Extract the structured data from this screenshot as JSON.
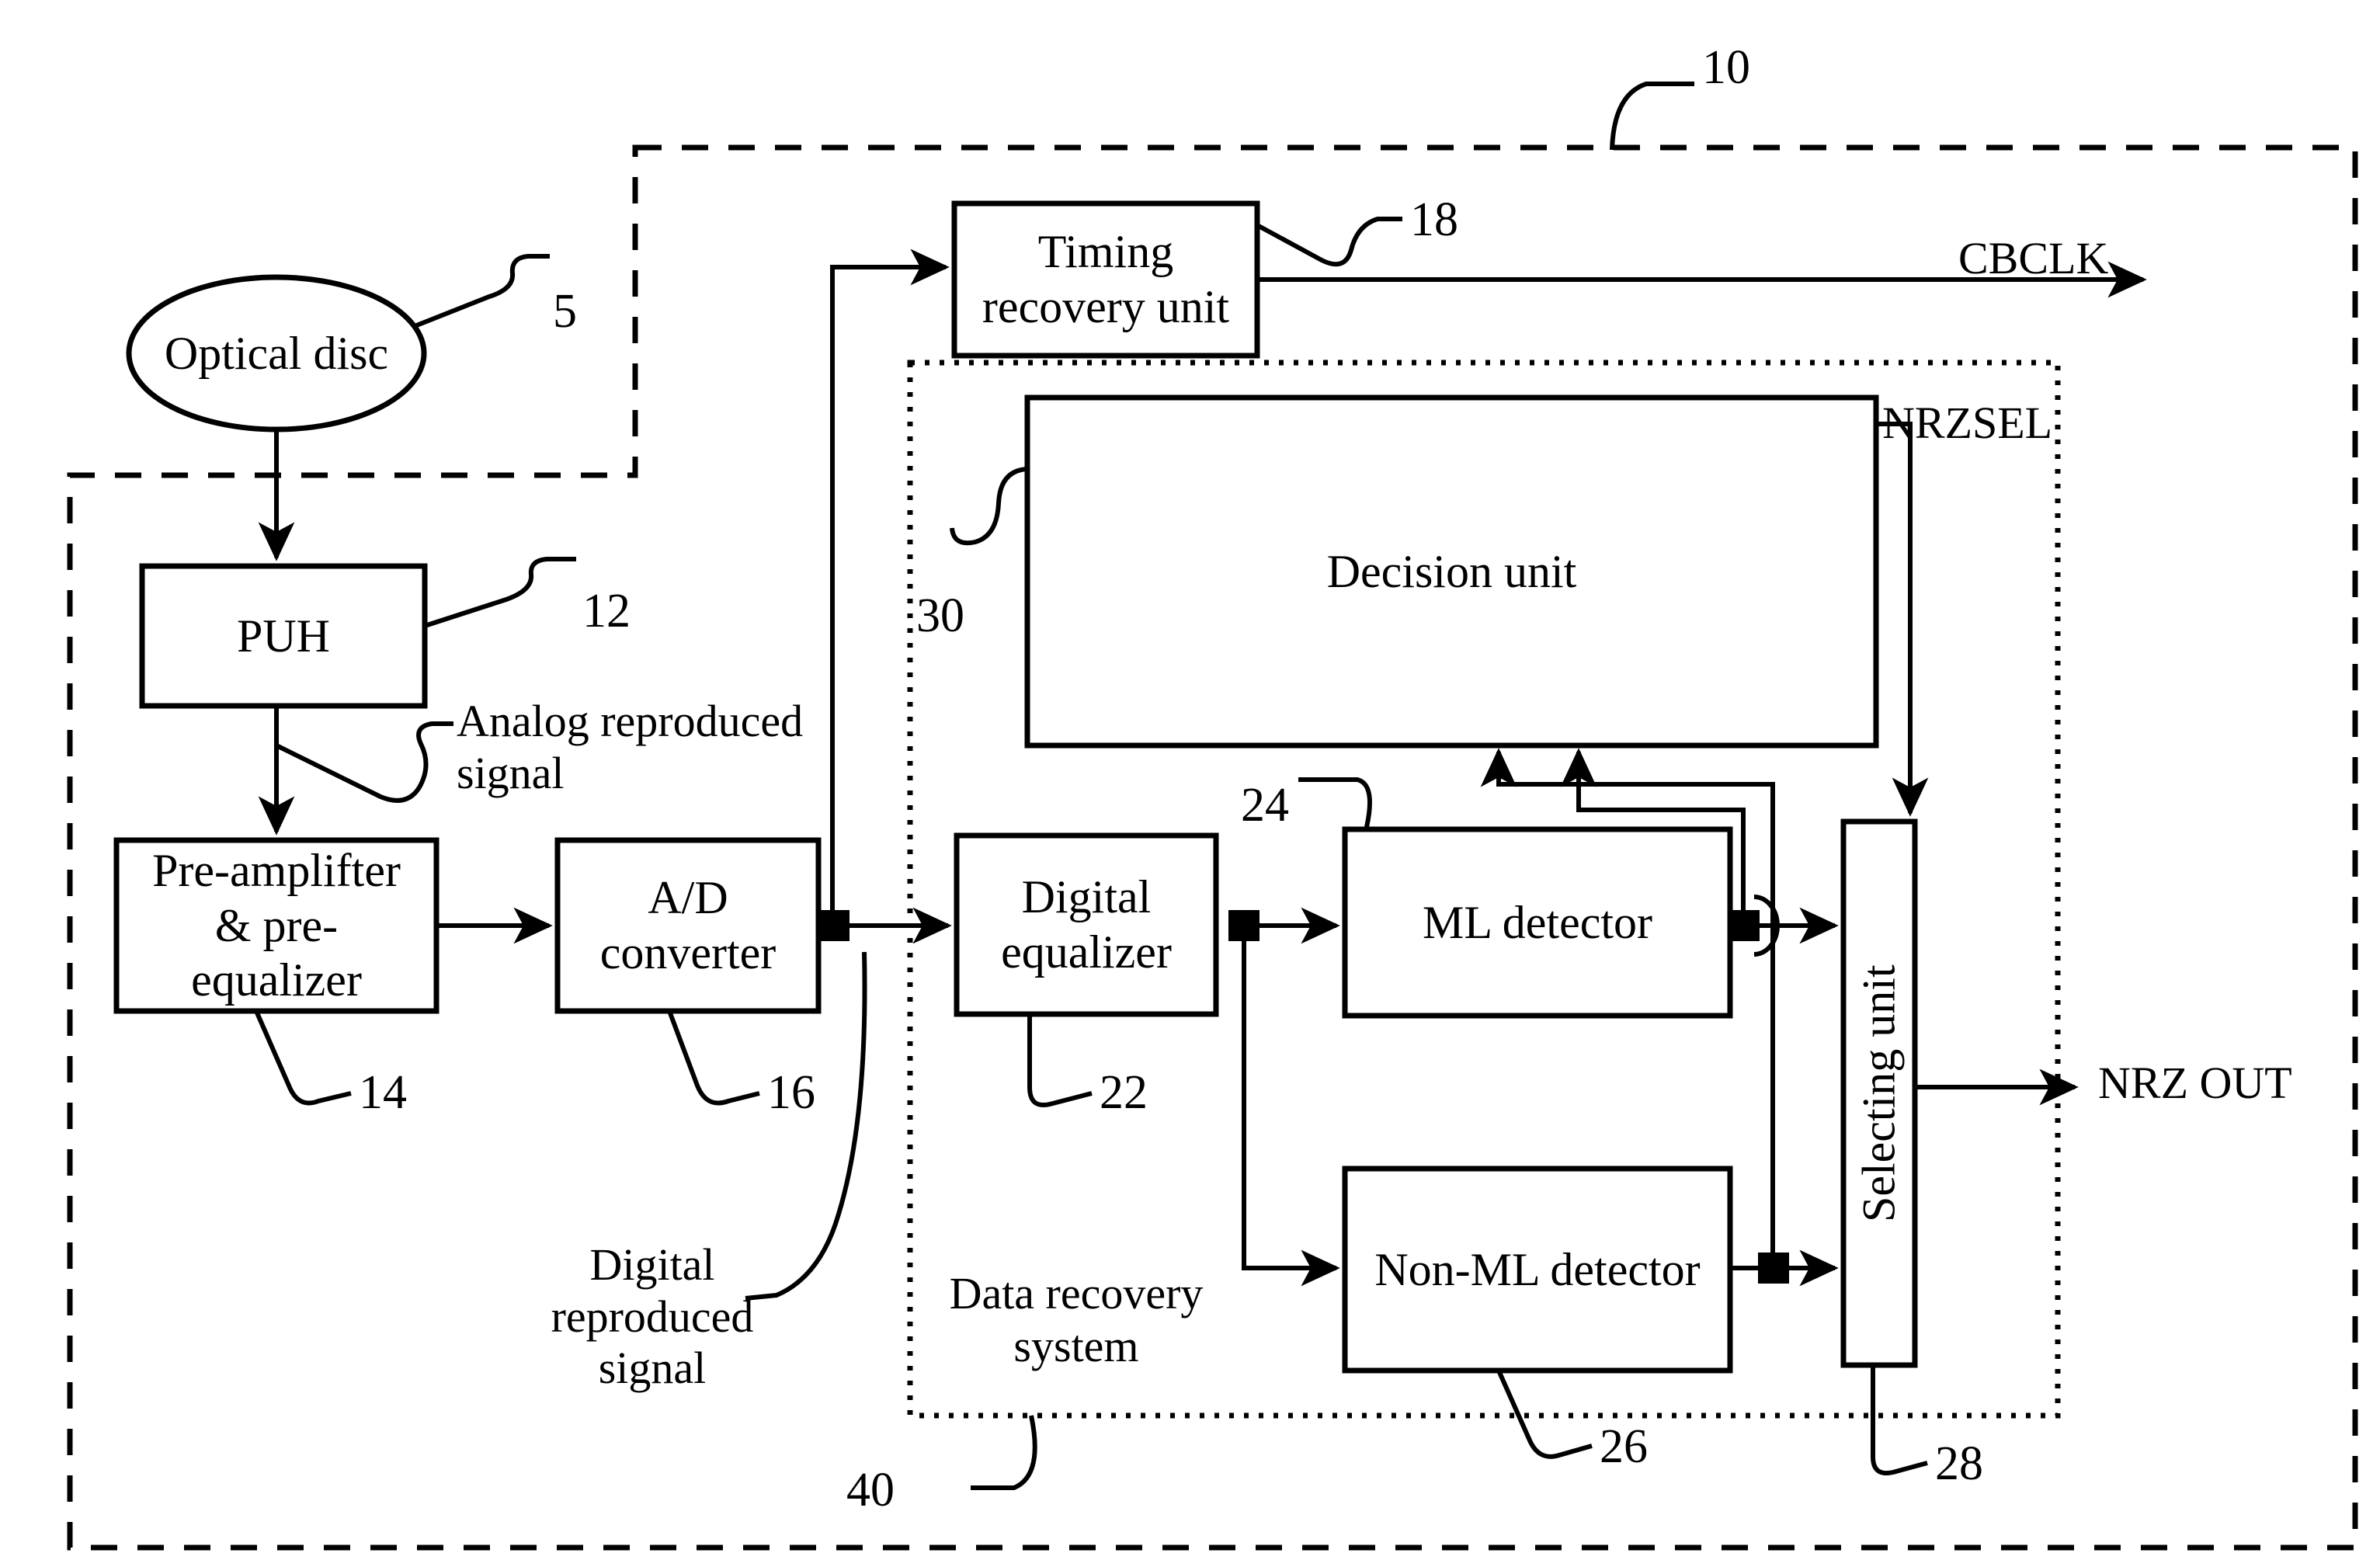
{
  "figure": {
    "title": "Optical disc data reproduction block diagram",
    "outer_ref": "10",
    "stroke_color": "#000000",
    "background_color": "#ffffff"
  },
  "blocks": {
    "optical_disc": {
      "label": "Optical disc",
      "ref": "5"
    },
    "puh": {
      "label": "PUH",
      "ref": "12"
    },
    "preamp": {
      "label": "Pre-amplifter\n& pre-\nequalizer",
      "ref": "14"
    },
    "adc": {
      "label": "A/D\nconverter",
      "ref": "16"
    },
    "timing": {
      "label": "Timing\nrecovery unit",
      "ref": "18"
    },
    "decision": {
      "label": "Decision unit",
      "ref": "30"
    },
    "digital_eq": {
      "label": "Digital\nequalizer",
      "ref": "22"
    },
    "ml": {
      "label": "ML detector",
      "ref": "24"
    },
    "nonml": {
      "label": "Non-ML detector",
      "ref": "26"
    },
    "selecting": {
      "label": "Selecting unit",
      "ref": "28"
    }
  },
  "groups": {
    "data_recovery_system": {
      "label": "Data recovery\nsystem",
      "ref": "40"
    }
  },
  "signals": {
    "analog_reproduced": "Analog reproduced\nsignal",
    "digital_reproduced": "Digital\nreproduced\nsignal",
    "cbclk": "CBCLK",
    "nrzsel": "NRZSEL",
    "nrz_out": "NRZ OUT"
  }
}
